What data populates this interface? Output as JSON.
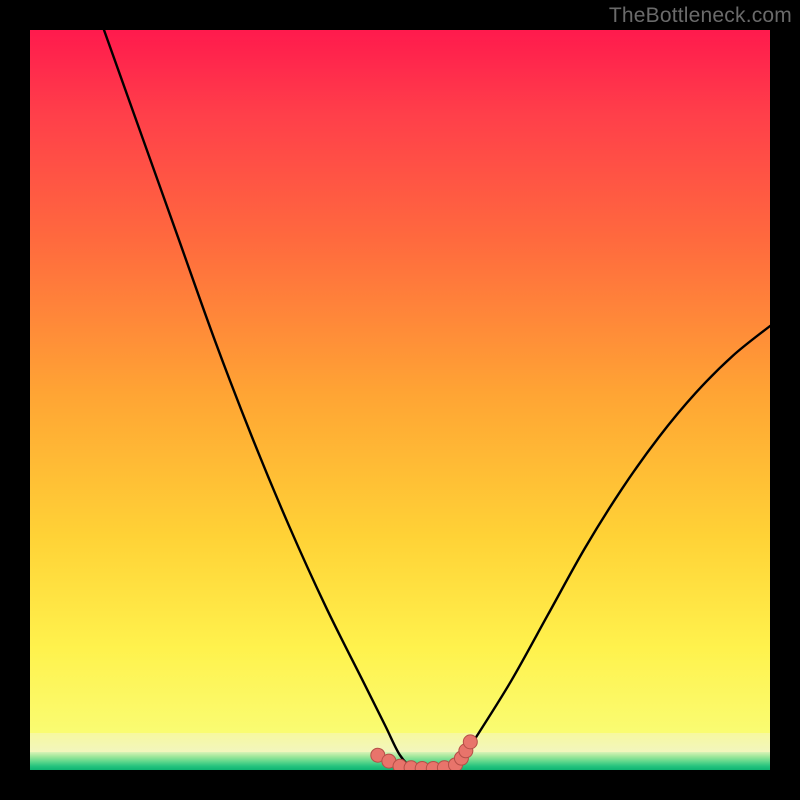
{
  "watermark": "TheBottleneck.com",
  "colors": {
    "frame": "#000000",
    "curve": "#000000",
    "marker_fill": "#e8746b",
    "marker_stroke": "#b54f47"
  },
  "chart_data": {
    "type": "line",
    "title": "",
    "xlabel": "",
    "ylabel": "",
    "xlim": [
      0,
      100
    ],
    "ylim": [
      0,
      100
    ],
    "grid": false,
    "note": "x is component-balance position; y is bottleneck percentage (0 at bottom, 100 at top). Shape is a V / bathtub with flat minimum near x≈50–58 and slightly shallower right arm.",
    "series": [
      {
        "name": "bottleneck-curve",
        "x": [
          10,
          15,
          20,
          25,
          30,
          35,
          40,
          45,
          48,
          50,
          52,
          54,
          56,
          58,
          60,
          65,
          70,
          75,
          80,
          85,
          90,
          95,
          100
        ],
        "y": [
          100,
          86,
          72,
          58,
          45,
          33,
          22,
          12,
          6,
          2,
          0,
          0,
          0,
          1,
          4,
          12,
          21,
          30,
          38,
          45,
          51,
          56,
          60
        ]
      }
    ],
    "markers": {
      "name": "optimal-range",
      "note": "points clustered along the flat bottom of the V, sitting on the green band",
      "x": [
        47,
        48.5,
        50,
        51.5,
        53,
        54.5,
        56,
        57.5,
        58.3,
        58.9,
        59.5
      ],
      "y": [
        2.0,
        1.2,
        0.5,
        0.3,
        0.2,
        0.2,
        0.3,
        0.7,
        1.6,
        2.6,
        3.8
      ]
    }
  }
}
